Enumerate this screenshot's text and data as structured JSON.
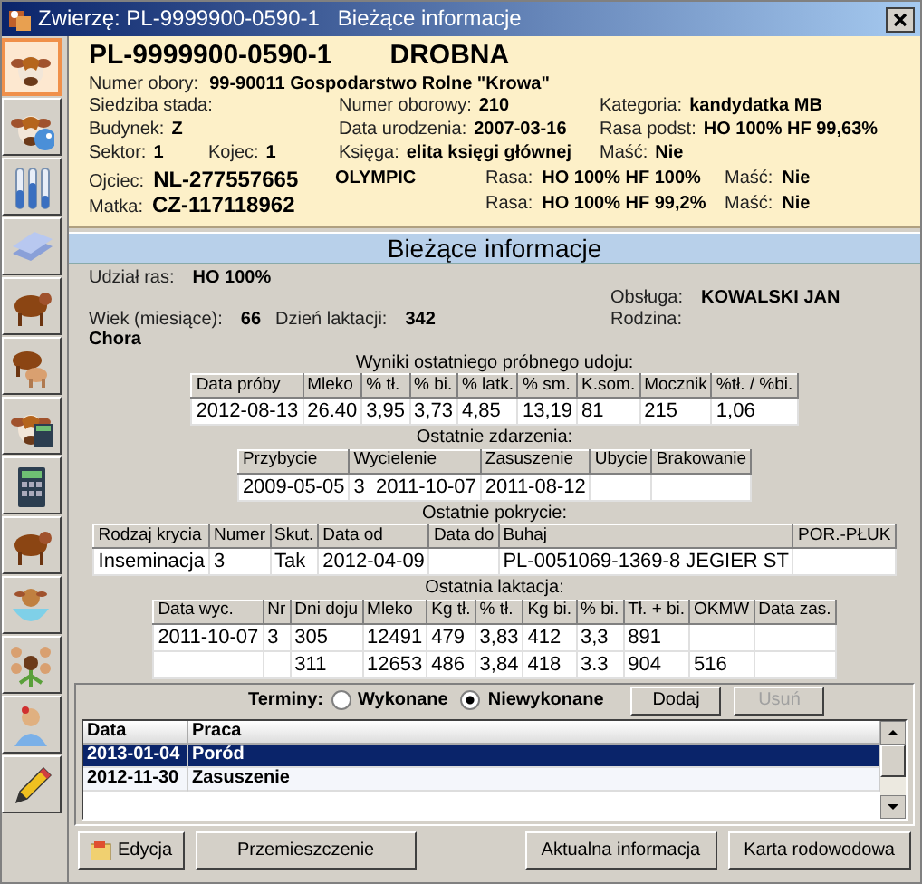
{
  "window": {
    "title": "Zwierzę: PL-9999900-0590-1   Bieżące informacje"
  },
  "sidebar": {
    "items": [
      {
        "kind": "cow-head",
        "selected": true
      },
      {
        "kind": "cow-ball",
        "selected": false
      },
      {
        "kind": "tubes",
        "selected": false
      },
      {
        "kind": "layers",
        "selected": false
      },
      {
        "kind": "cow-body",
        "selected": false
      },
      {
        "kind": "cows",
        "selected": false
      },
      {
        "kind": "cow-calc",
        "selected": false
      },
      {
        "kind": "calculator",
        "selected": false
      },
      {
        "kind": "cow-body",
        "selected": false
      },
      {
        "kind": "calf-bowl",
        "selected": false
      },
      {
        "kind": "tree",
        "selected": false
      },
      {
        "kind": "person",
        "selected": false
      },
      {
        "kind": "pencil",
        "selected": false
      }
    ]
  },
  "header": {
    "id": "PL-9999900-0590-1",
    "type": "DROBNA",
    "farm": {
      "label": "Numer obory:",
      "value": "99-90011 Gospodarstwo Rolne \"Krowa\""
    },
    "columns": [
      [
        [
          {
            "label": "Siedziba stada:"
          }
        ],
        [
          {
            "label": "Budynek:",
            "value": "Z"
          }
        ],
        [
          {
            "label": "Sektor:",
            "value": "1"
          },
          {
            "label": "Kojec:",
            "value": "1"
          }
        ]
      ],
      [
        [
          {
            "label": "Numer oborowy:",
            "value": "210"
          }
        ],
        [
          {
            "label": "Data urodzenia:",
            "value": "2007-03-16"
          }
        ],
        [
          {
            "label": "Księga:",
            "value": "elita księgi głównej"
          }
        ]
      ],
      [
        [
          {
            "label": "Kategoria:",
            "value": "kandydatka MB"
          }
        ],
        [
          {
            "label": "Rasa podst:",
            "value": "HO 100% HF 99,63%"
          }
        ],
        [
          {
            "label": "Maść:",
            "value": "Nie"
          }
        ]
      ]
    ],
    "parents": [
      {
        "label": "Ojciec:",
        "id": "NL-277557665",
        "name": "OLYMPIC",
        "breed_label": "Rasa:",
        "breed": "HO 100% HF 100%",
        "coat_label": "Maść:",
        "coat": "Nie"
      },
      {
        "label": "Matka:",
        "id": "CZ-117118962",
        "breed_label": "Rasa:",
        "breed": "HO 100% HF 99,2%",
        "coat_label": "Maść:",
        "coat": "Nie"
      }
    ]
  },
  "section_title": "Bieżące informacje",
  "info": {
    "breed_share": {
      "label": "Udział ras:",
      "value": "HO 100%"
    },
    "staff": {
      "label": "Obsługa:",
      "value": "KOWALSKI JAN"
    },
    "age": {
      "label": "Wiek (miesiące):",
      "value": "66"
    },
    "lactation_day": {
      "label": "Dzień laktacji:",
      "value": "342"
    },
    "family": {
      "label": "Rodzina:"
    },
    "status": "Chora"
  },
  "tables": [
    {
      "title": "Wyniki ostatniego próbnego udoju:",
      "columns": [
        "Data próby",
        "Mleko",
        "% tł.",
        "% bi.",
        "% latk.",
        "% sm.",
        "K.som.",
        "Mocznik",
        "%tł. / %bi."
      ],
      "rows": [
        [
          "2012-08-13",
          "26.40",
          "3,95",
          "3,73",
          "4,85",
          "13,19",
          "81",
          "215",
          "1,06"
        ]
      ]
    },
    {
      "title": "Ostatnie zdarzenia:",
      "columns": [
        "Przybycie",
        "Wycielenie",
        "Zasuszenie",
        "Ubycie",
        "Brakowanie"
      ],
      "rows": [
        [
          "2009-05-05",
          "3  2011-10-07",
          "2011-08-12",
          null,
          null
        ]
      ]
    },
    {
      "title": "Ostatnie pokrycie:",
      "columns": [
        "Rodzaj krycia",
        "Numer",
        "Skut.",
        "Data od",
        "Data do",
        "Buhaj",
        "POR.-PŁUK"
      ],
      "rows": [
        [
          "Inseminacja",
          "3",
          "Tak",
          "2012-04-09",
          null,
          "PL-0051069-1369-8 JEGIER ST",
          null
        ]
      ]
    },
    {
      "title": "Ostatnia laktacja:",
      "columns": [
        "Data wyc.",
        "Nr",
        "Dni doju",
        "Mleko",
        "Kg tł.",
        "% tł.",
        "Kg bi.",
        "% bi.",
        "Tł. + bi.",
        "OKMW",
        "Data zas."
      ],
      "rows": [
        [
          "2011-10-07",
          "3",
          "305",
          "12491",
          "479",
          "3,83",
          "412",
          "3,3",
          "891",
          null,
          null
        ],
        [
          null,
          null,
          "311",
          "12653",
          "486",
          "3,84",
          "418",
          "3.3",
          "904",
          "516",
          null
        ]
      ]
    }
  ],
  "terms": {
    "label": "Terminy:",
    "options": [
      {
        "label": "Wykonane",
        "selected": false
      },
      {
        "label": "Niewykonane",
        "selected": true
      }
    ],
    "buttons": [
      {
        "label": "Dodaj",
        "disabled": false
      },
      {
        "label": "Usuń",
        "disabled": true
      }
    ],
    "columns": [
      "Data",
      "Praca"
    ],
    "rows": [
      {
        "date": "2013-01-04",
        "task": "Poród",
        "selected": true
      },
      {
        "date": "2012-11-30",
        "task": "Zasuszenie",
        "selected": false
      }
    ]
  },
  "footer_buttons": [
    {
      "label": "Edycja",
      "kind": "edit"
    },
    {
      "label": "Przemieszczenie",
      "kind": "plain"
    },
    {
      "label": "Aktualna informacja",
      "kind": "plain"
    },
    {
      "label": "Karta rodowodowa",
      "kind": "plain"
    }
  ]
}
